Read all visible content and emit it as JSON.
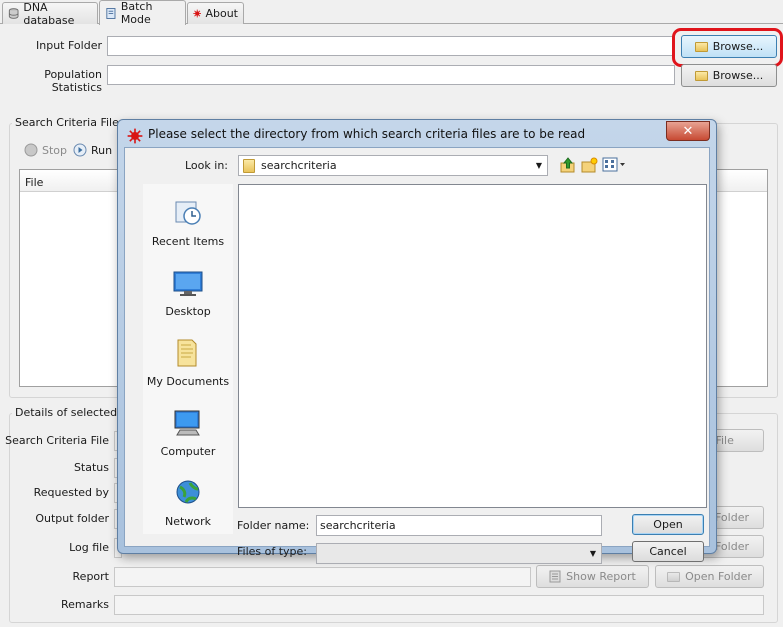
{
  "tabs": [
    {
      "label": "DNA database",
      "icon": "database-icon"
    },
    {
      "label": "Batch Mode",
      "icon": "notebook-icon"
    },
    {
      "label": "About",
      "icon": "app-logo-icon"
    }
  ],
  "form": {
    "input_folder_label": "Input Folder",
    "population_statistics_label": "Population Statistics",
    "browse_label": "Browse...",
    "browse_label_2": "Browse..."
  },
  "search_criteria": {
    "title": "Search Criteria Files",
    "stop_label": "Stop",
    "run_label": "Run",
    "file_column": "File"
  },
  "details": {
    "title": "Details of selected se",
    "search_criteria_file_label": "Search Criteria File",
    "status_label": "Status",
    "requested_by_label": "Requested by",
    "output_folder_label": "Output folder",
    "log_file_label": "Log file",
    "report_label": "Report",
    "remarks_label": "Remarks",
    "open_file_label": "n File",
    "open_folder_partial_1": "Folder",
    "open_folder_partial_2": "Folder",
    "show_report_label": "Show Report",
    "open_folder_label": "Open Folder"
  },
  "dialog": {
    "title": "Please select the directory from which search criteria files are to be read",
    "close_symbol": "✕",
    "look_in_label": "Look in:",
    "look_in_value": "searchcriteria",
    "places": [
      {
        "label": "Recent Items",
        "icon": "recent-items-icon"
      },
      {
        "label": "Desktop",
        "icon": "desktop-icon"
      },
      {
        "label": "My Documents",
        "icon": "my-documents-icon"
      },
      {
        "label": "Computer",
        "icon": "computer-icon"
      },
      {
        "label": "Network",
        "icon": "network-icon"
      }
    ],
    "folder_name_label": "Folder name:",
    "folder_name_value": "searchcriteria",
    "files_of_type_label": "Files of type:",
    "files_of_type_value": "",
    "open_label": "Open",
    "cancel_label": "Cancel"
  },
  "colors": {
    "highlight_ring": "#e0141b",
    "dialog_frame": "#a8c1dd"
  }
}
